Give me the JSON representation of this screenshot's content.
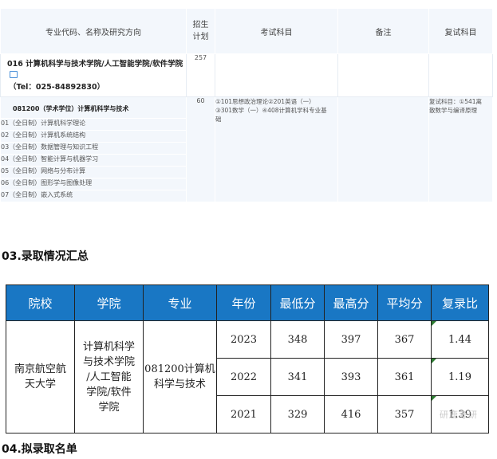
{
  "catalog": {
    "headers": {
      "code_name": "专业代码、名称及研究方向",
      "quota": "招生计划",
      "quota_line1": "招生",
      "quota_line2": "计划",
      "exam": "考试科目",
      "note": "备注",
      "retest": "复试科目"
    },
    "dept": {
      "name": "016 计算机科学与技术学院/人工智能学院/软件学院",
      "tel": "（Tel：025-84892830）",
      "quota": "257"
    },
    "major": {
      "name": "081200（学术学位）计算机科学与技术",
      "quota": "60",
      "exam_line1": "①101思想政治理论②201英语（一）",
      "exam_line2": "③301数学（一）④408计算机学科专业基",
      "exam_line3": "础",
      "retest_line1": "复试科目：①541离",
      "retest_line2": "散数学与编译原理"
    },
    "directions": [
      "01（全日制）计算机科学理论",
      "02（全日制）计算机系统结构",
      "03（全日制）数据管理与知识工程",
      "04（全日制）智能计算与机器学习",
      "05（全日制）网络与分布计算",
      "06（全日制）图形学与图像处理",
      "07（全日制）嵌入式系统"
    ]
  },
  "section3_title": "03.录取情况汇总",
  "section4_title": "04.拟录取名单",
  "admission": {
    "headers": [
      "院校",
      "学院",
      "专业",
      "年份",
      "最低分",
      "最高分",
      "平均分",
      "复录比"
    ],
    "school_line1": "南京航空航",
    "school_line2": "天大学",
    "college_lines": [
      "计算机科学",
      "与技术学院",
      "/人工智能",
      "学院/软件",
      "学院"
    ],
    "major_line1": "081200计算机",
    "major_line2": "科学与技术",
    "rows": [
      {
        "year": "2023",
        "min": "348",
        "max": "397",
        "avg": "367",
        "ratio": "1.44"
      },
      {
        "year": "2022",
        "min": "341",
        "max": "393",
        "avg": "361",
        "ratio": "1.19"
      },
      {
        "year": "2021",
        "min": "329",
        "max": "416",
        "avg": "357",
        "ratio": "1.39"
      }
    ]
  },
  "watermark": "研鹿考研",
  "colors": {
    "header_blue": "#1977c4",
    "catalog_bg": "#f3f7fc",
    "marker_green": "#2e7d32"
  }
}
